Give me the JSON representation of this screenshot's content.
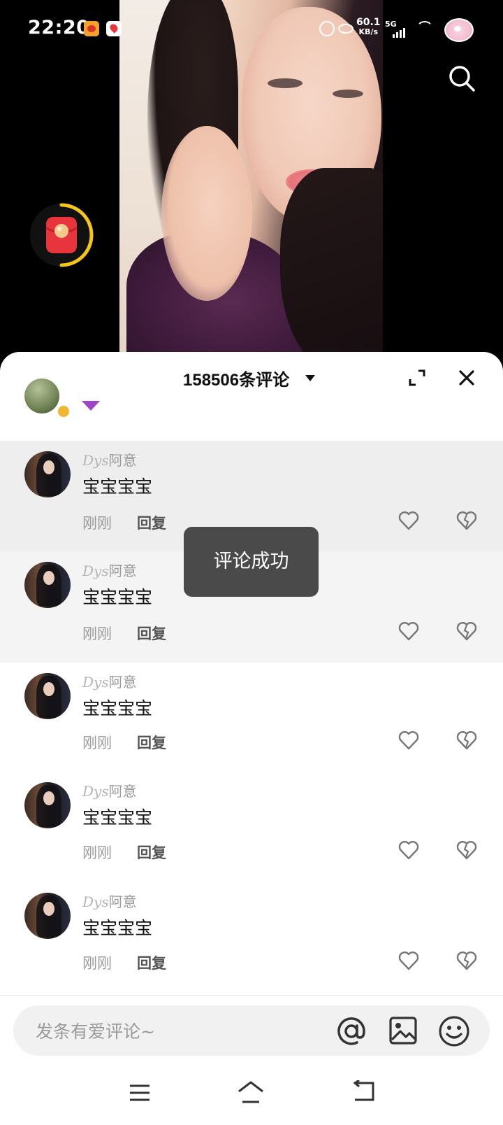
{
  "status_bar": {
    "time": "22:20",
    "net_speed_value": "60.1",
    "net_speed_unit": "KB/s",
    "network_type": "5G",
    "icons": [
      "weibo-app-icon",
      "map-app-icon",
      "alarm-icon",
      "eye-protection-icon",
      "signal-icon",
      "wifi-icon",
      "battery-icon"
    ]
  },
  "video": {
    "search_icon": "search-icon",
    "red_packet_icon": "red-packet-icon"
  },
  "comments_sheet": {
    "title": "158506条评论",
    "expand_icon": "expand-icon",
    "close_icon": "close-icon",
    "comments": [
      {
        "user_sig": "Dys",
        "user_name": "阿意",
        "text": "宝宝宝宝",
        "time": "刚刚",
        "reply_label": "回复"
      },
      {
        "user_sig": "Dys",
        "user_name": "阿意",
        "text": "宝宝宝宝",
        "time": "刚刚",
        "reply_label": "回复"
      },
      {
        "user_sig": "Dys",
        "user_name": "阿意",
        "text": "宝宝宝宝",
        "time": "刚刚",
        "reply_label": "回复"
      },
      {
        "user_sig": "Dys",
        "user_name": "阿意",
        "text": "宝宝宝宝",
        "time": "刚刚",
        "reply_label": "回复"
      },
      {
        "user_sig": "Dys",
        "user_name": "阿意",
        "text": "宝宝宝宝",
        "time": "刚刚",
        "reply_label": "回复"
      }
    ],
    "toast": "评论成功"
  },
  "input_bar": {
    "placeholder": "发条有爱评论~",
    "icons": [
      "at-mention-icon",
      "image-icon",
      "emoji-icon"
    ]
  },
  "nav_bar": {
    "icons": [
      "menu-icon",
      "home-icon",
      "back-icon"
    ]
  },
  "colors": {
    "sheet_bg": "#ffffff",
    "highlight_row": "#eeeeee",
    "toast_bg": "#4a4a4a",
    "muted_text": "#9a9a9a",
    "red_packet": "#e8343c",
    "progress_ring": "#f5c518"
  }
}
